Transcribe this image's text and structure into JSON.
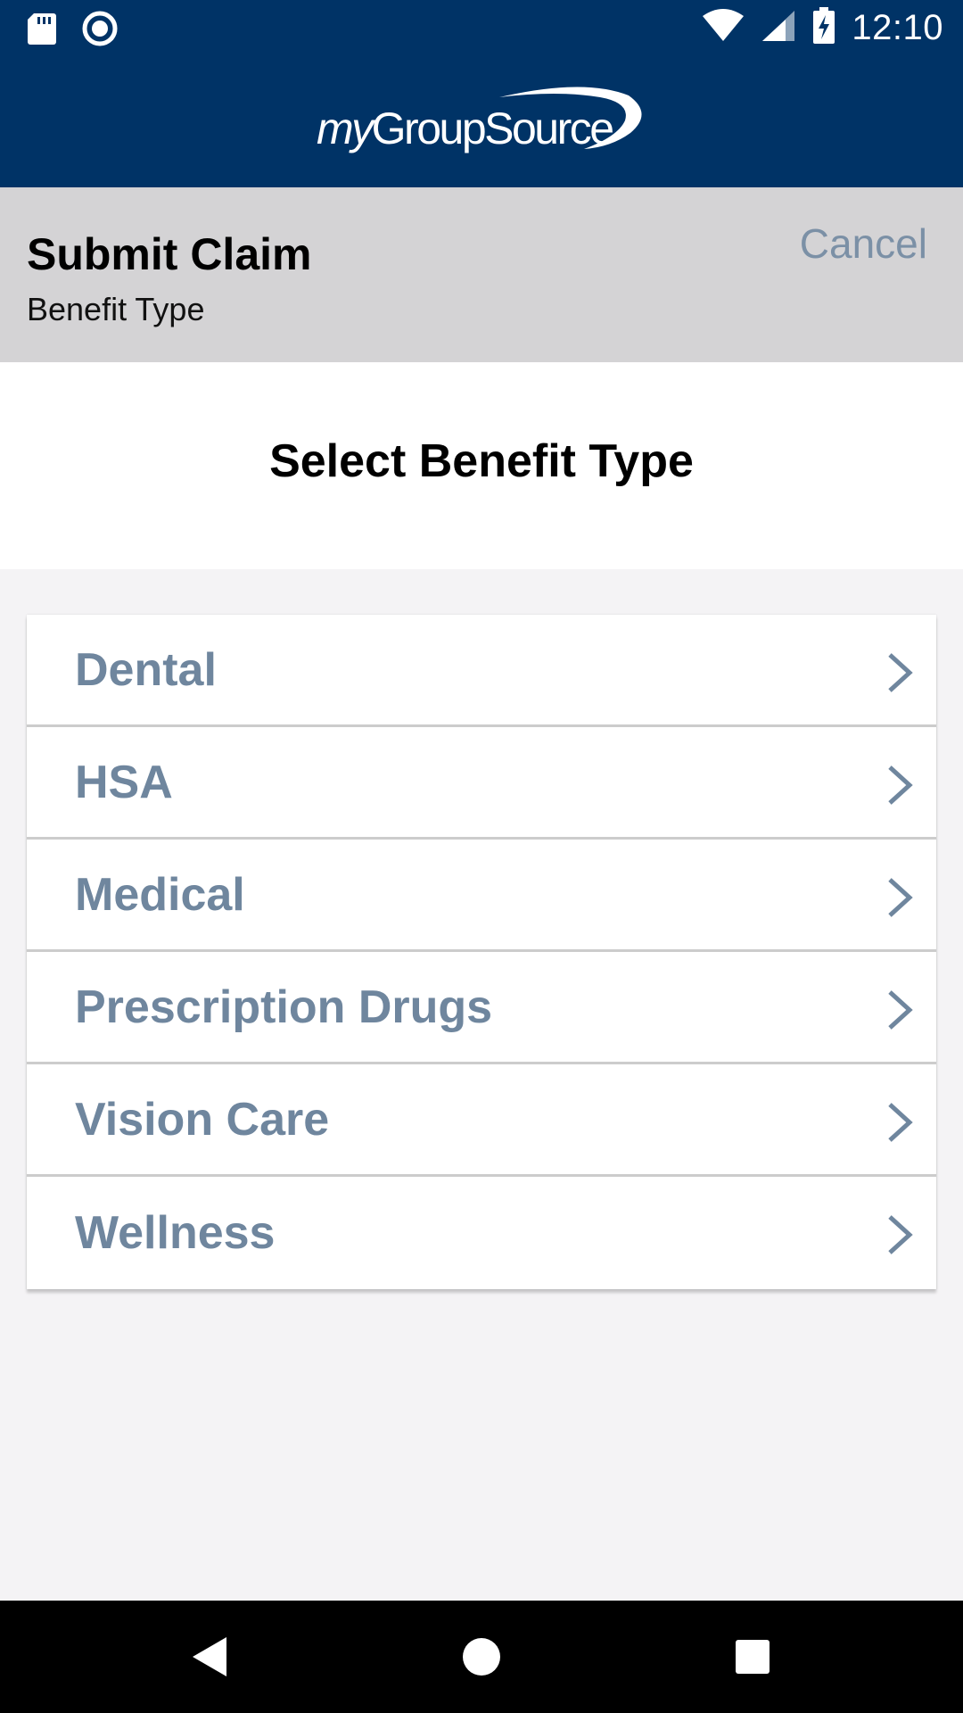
{
  "status_bar": {
    "time": "12:10",
    "left_icons": [
      "sd-card-icon",
      "record-icon"
    ],
    "right_icons": [
      "wifi-icon",
      "cell-signal-icon",
      "battery-charging-icon"
    ]
  },
  "header": {
    "logo_prefix": "my",
    "logo_main": "GroupSource",
    "background": "#003366"
  },
  "title_bar": {
    "title": "Submit Claim",
    "subtitle": "Benefit Type",
    "cancel_label": "Cancel"
  },
  "main": {
    "heading": "Select Benefit Type",
    "benefit_types": [
      {
        "label": "Dental"
      },
      {
        "label": "HSA"
      },
      {
        "label": "Medical"
      },
      {
        "label": "Prescription Drugs"
      },
      {
        "label": "Vision Care"
      },
      {
        "label": "Wellness"
      }
    ],
    "item_text_color": "#6f869e"
  },
  "nav_bar": {
    "buttons": [
      "back-icon",
      "home-icon",
      "recents-icon"
    ]
  }
}
